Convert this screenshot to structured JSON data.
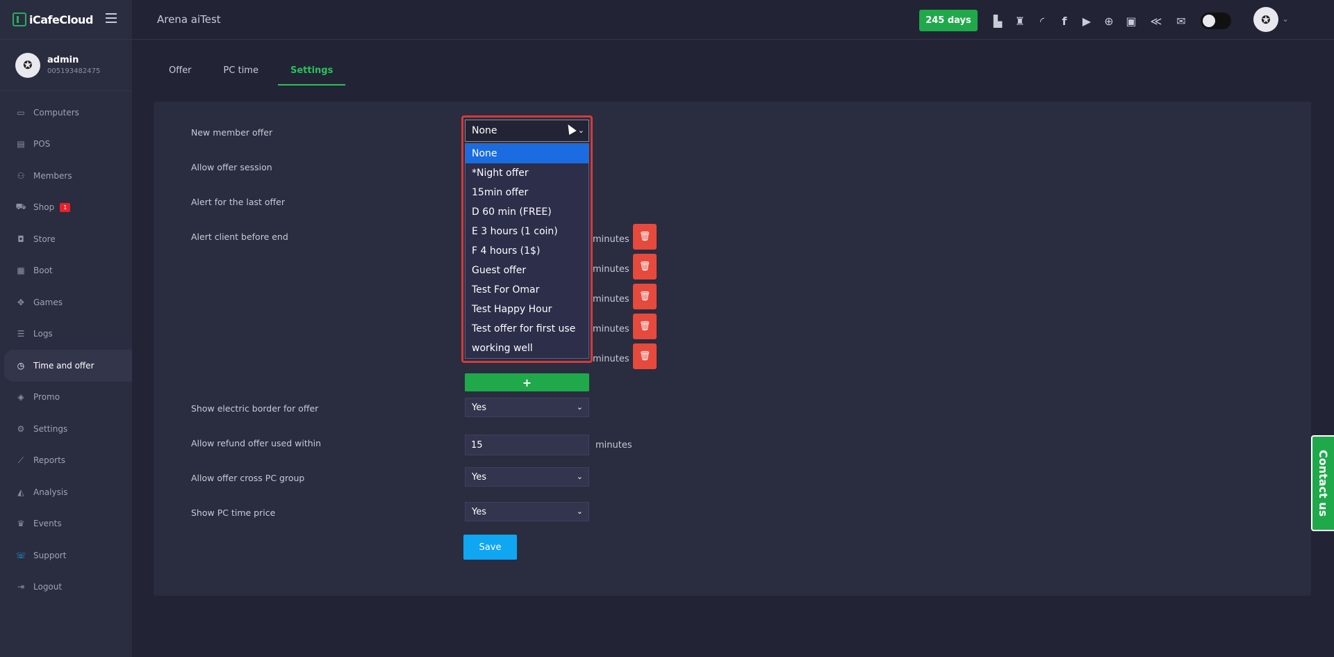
{
  "brand": {
    "name": "iCafeCloud"
  },
  "user": {
    "name": "admin",
    "id": "005193482475"
  },
  "sidebar": {
    "items": [
      {
        "label": "Computers",
        "icon": "monitor-icon"
      },
      {
        "label": "POS",
        "icon": "cash-register-icon"
      },
      {
        "label": "Members",
        "icon": "users-icon"
      },
      {
        "label": "Shop",
        "icon": "cart-icon",
        "badge": "1"
      },
      {
        "label": "Store",
        "icon": "bag-icon"
      },
      {
        "label": "Boot",
        "icon": "windows-icon"
      },
      {
        "label": "Games",
        "icon": "gamepad-icon"
      },
      {
        "label": "Logs",
        "icon": "list-icon"
      },
      {
        "label": "Time and offer",
        "icon": "stopwatch-icon",
        "active": true
      },
      {
        "label": "Promo",
        "icon": "tag-icon"
      },
      {
        "label": "Settings",
        "icon": "gear-icon"
      },
      {
        "label": "Reports",
        "icon": "line-chart-icon"
      },
      {
        "label": "Analysis",
        "icon": "area-chart-icon"
      },
      {
        "label": "Events",
        "icon": "crown-icon"
      },
      {
        "label": "Support",
        "icon": "phone-icon"
      },
      {
        "label": "Logout",
        "icon": "logout-icon"
      }
    ]
  },
  "header": {
    "shop_title": "Arena aiTest",
    "days_left": "245 days",
    "icons": [
      "ranking-icon",
      "trophy-icon",
      "rss-icon",
      "facebook-icon",
      "youtube-icon",
      "globe-icon",
      "icafe-icon",
      "handshake-icon",
      "mail-icon"
    ]
  },
  "tabs": [
    {
      "label": "Offer"
    },
    {
      "label": "PC time"
    },
    {
      "label": "Settings",
      "active": true
    }
  ],
  "settings": {
    "new_member_offer": {
      "label": "New member offer",
      "value": "None"
    },
    "allow_offer_session": {
      "label": "Allow offer session"
    },
    "alert_last_offer": {
      "label": "Alert for the last offer"
    },
    "alert_before_end": {
      "label": "Alert client before end",
      "unit": "minutes"
    },
    "electric_border": {
      "label": "Show electric border for offer",
      "value": "Yes"
    },
    "refund_within": {
      "label": "Allow refund offer used within",
      "value": "15",
      "unit": "minutes"
    },
    "cross_pc_group": {
      "label": "Allow offer cross PC group",
      "value": "Yes"
    },
    "show_pc_time_price": {
      "label": "Show PC time price",
      "value": "Yes"
    },
    "add_label": "+",
    "save_label": "Save"
  },
  "dropdown": {
    "options": [
      "None",
      "*Night offer",
      "15min offer",
      "D 60 min (FREE)",
      "E 3 hours (1 coin)",
      "F 4 hours (1$)",
      "Guest offer",
      "Test For Omar",
      "Test Happy Hour",
      "Test offer for first use",
      "working well"
    ],
    "selected": "None"
  },
  "contact": {
    "label": "Contact us"
  }
}
